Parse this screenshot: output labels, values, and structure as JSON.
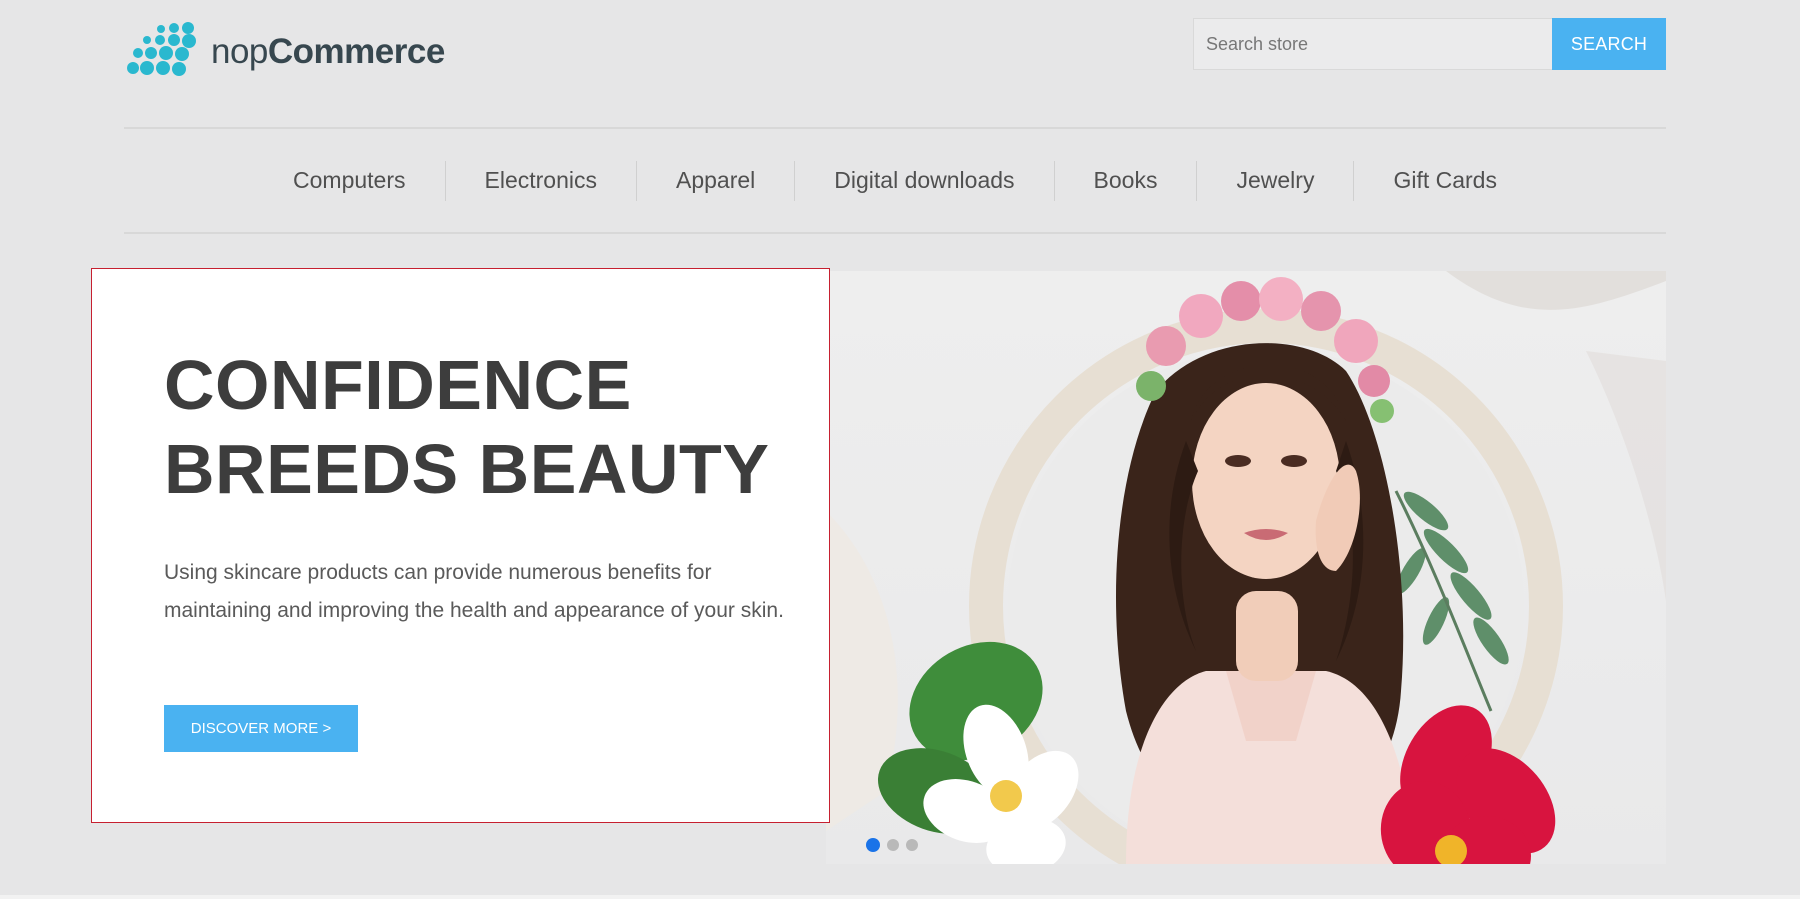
{
  "brand": {
    "prefix": "nop",
    "name": "Commerce",
    "logo_icon": "dot-grid-logo-icon",
    "accent": "#2ab8cf"
  },
  "search": {
    "placeholder": "Search store",
    "button_label": "SEARCH",
    "button_color": "#4ab2f1"
  },
  "nav": {
    "items": [
      {
        "label": "Computers"
      },
      {
        "label": "Electronics"
      },
      {
        "label": "Apparel"
      },
      {
        "label": "Digital downloads"
      },
      {
        "label": "Books"
      },
      {
        "label": "Jewelry"
      },
      {
        "label": "Gift Cards"
      }
    ]
  },
  "slider": {
    "title_line1": "CONFIDENCE",
    "title_line2": "BREEDS BEAUTY",
    "text": "Using skincare products can provide numerous benefits for maintaining and improving the health and appearance of your skin.",
    "button_label": "DISCOVER MORE >",
    "active_slide": 1,
    "slide_count": 3,
    "image": "woman-with-flower-crown-image"
  }
}
